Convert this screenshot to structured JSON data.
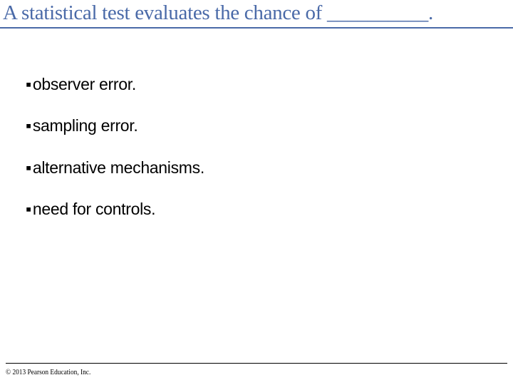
{
  "slide": {
    "title": "A statistical test evaluates the chance of __________.",
    "options": [
      "observer error.",
      "sampling error.",
      "alternative mechanisms.",
      "need for controls."
    ],
    "copyright": "© 2013 Pearson Education, Inc."
  }
}
